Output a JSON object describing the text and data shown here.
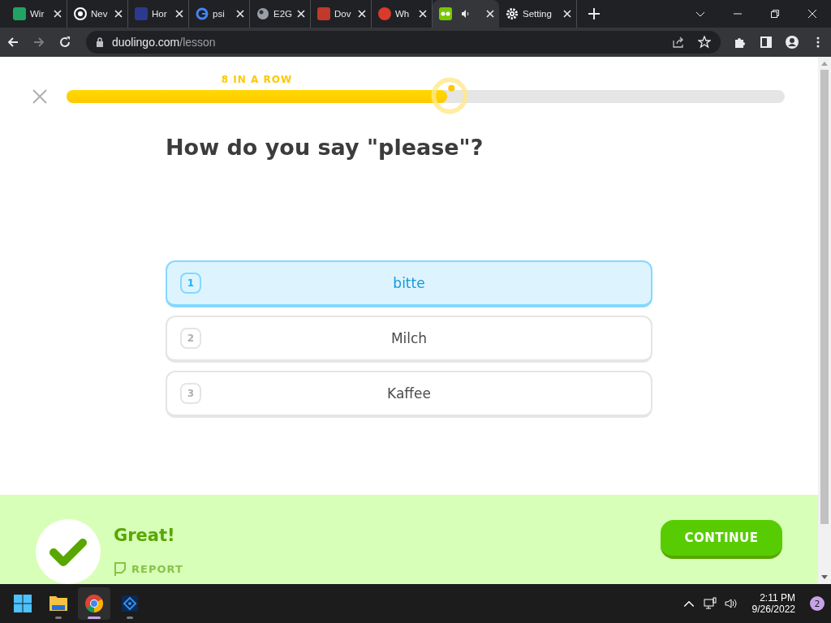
{
  "browser": {
    "tabs": [
      {
        "title": "Wir",
        "selected": false,
        "audio": false
      },
      {
        "title": "Nev",
        "selected": false,
        "audio": false
      },
      {
        "title": "Hor",
        "selected": false,
        "audio": false
      },
      {
        "title": "psi",
        "selected": false,
        "audio": false
      },
      {
        "title": "E2G",
        "selected": false,
        "audio": false
      },
      {
        "title": "Dov",
        "selected": false,
        "audio": false
      },
      {
        "title": "Wh",
        "selected": false,
        "audio": false
      },
      {
        "selected": true,
        "audio": true
      },
      {
        "title": "Setting",
        "selected": false,
        "audio": false
      }
    ],
    "url": {
      "host": "duolingo.com",
      "path": "/lesson"
    }
  },
  "lesson": {
    "streak": "8 IN A ROW",
    "progress": {
      "level": 0.53
    },
    "question": "How do you say \"please\"?",
    "choices": [
      {
        "key": "1",
        "text": "bitte",
        "selected": true
      },
      {
        "key": "2",
        "text": "Milch",
        "selected": false
      },
      {
        "key": "3",
        "text": "Kaffee",
        "selected": false
      }
    ],
    "feedback": {
      "message": "Great!",
      "report": "REPORT",
      "button": "CONTINUE"
    }
  },
  "taskbar": {
    "apps": [
      {
        "selected": false
      },
      {
        "selected": false
      },
      {
        "selected": true
      },
      {
        "selected": false
      }
    ],
    "time": "2:11 PM",
    "date": "9/26/2022",
    "notifications": "2"
  }
}
